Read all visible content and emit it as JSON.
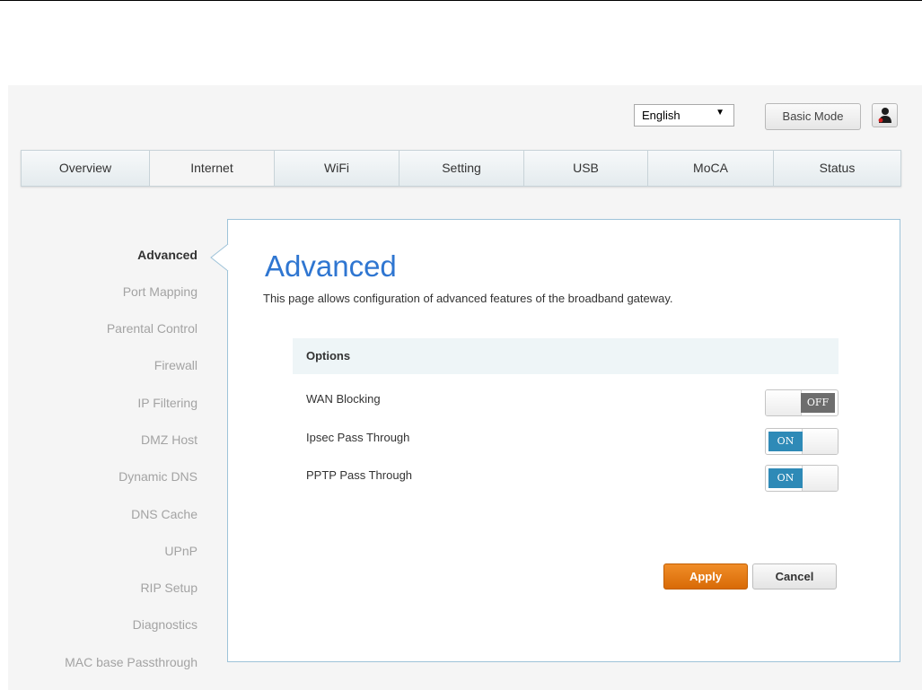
{
  "header": {
    "language_selected": "English",
    "basic_mode_label": "Basic Mode",
    "user_icon": "user-icon"
  },
  "nav": {
    "tabs": [
      {
        "label": "Overview"
      },
      {
        "label": "Internet"
      },
      {
        "label": "WiFi"
      },
      {
        "label": "Setting"
      },
      {
        "label": "USB"
      },
      {
        "label": "MoCA"
      },
      {
        "label": "Status"
      }
    ],
    "active_tab": "Internet"
  },
  "sidebar": {
    "items": [
      {
        "label": "Advanced"
      },
      {
        "label": "Port Mapping"
      },
      {
        "label": "Parental Control"
      },
      {
        "label": "Firewall"
      },
      {
        "label": "IP Filtering"
      },
      {
        "label": "DMZ Host"
      },
      {
        "label": "Dynamic DNS"
      },
      {
        "label": "DNS Cache"
      },
      {
        "label": "UPnP"
      },
      {
        "label": "RIP Setup"
      },
      {
        "label": "Diagnostics"
      },
      {
        "label": "MAC base Passthrough"
      }
    ],
    "active_item": "Advanced"
  },
  "main": {
    "title": "Advanced",
    "description": "This page allows configuration of advanced features of the broadband gateway.",
    "options_header": "Options",
    "options": [
      {
        "label": "WAN Blocking",
        "state": "OFF"
      },
      {
        "label": "Ipsec Pass Through",
        "state": "ON"
      },
      {
        "label": "PPTP Pass Through",
        "state": "ON"
      }
    ],
    "apply_label": "Apply",
    "cancel_label": "Cancel"
  },
  "colors": {
    "accent_blue": "#2f76d1",
    "toggle_on": "#2e8ab7",
    "toggle_off": "#6d6d6d",
    "apply_orange": "#e57a14",
    "panel_border": "#9ec3d9"
  }
}
